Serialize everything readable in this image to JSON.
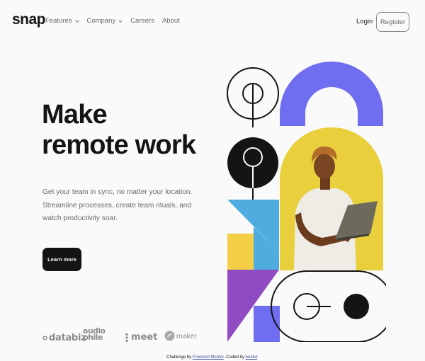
{
  "brand": {
    "logo": "snap"
  },
  "nav": {
    "items": [
      {
        "label": "Features",
        "has_dropdown": true
      },
      {
        "label": "Company",
        "has_dropdown": true
      },
      {
        "label": "Careers",
        "has_dropdown": false
      },
      {
        "label": "About",
        "has_dropdown": false
      }
    ],
    "login_label": "Login",
    "register_label": "Register"
  },
  "hero": {
    "headline_line1": "Make",
    "headline_line2": "remote work",
    "subtext": "Get your team in sync, no matter your location. Streamline processes, create team rituals, and watch productivity soar.",
    "cta_label": "Learn more"
  },
  "clients": {
    "databiz": "databiz",
    "audiophile_line1": "audio",
    "audiophile_line2": "phile",
    "meet": "meet",
    "maker": "maker"
  },
  "footer": {
    "prefix": "Challenge by ",
    "link1": "Frontend Mentor",
    "middle": ". Coded by ",
    "link2": "bo464",
    "suffix": "."
  },
  "colors": {
    "background": "#fafafa",
    "text_dark": "#141414",
    "text_gray": "#696969",
    "accent_purple": "#6f6ef0",
    "accent_yellow": "#e9cf3b",
    "accent_blue": "#4eadde",
    "accent_violet": "#8f4bc1",
    "accent_amber": "#f4cf45"
  },
  "icons": {
    "dropdown": "chevron-down-icon",
    "client_icons": [
      "databiz-logo",
      "audiophile-logo",
      "meet-logo",
      "maker-logo"
    ]
  }
}
